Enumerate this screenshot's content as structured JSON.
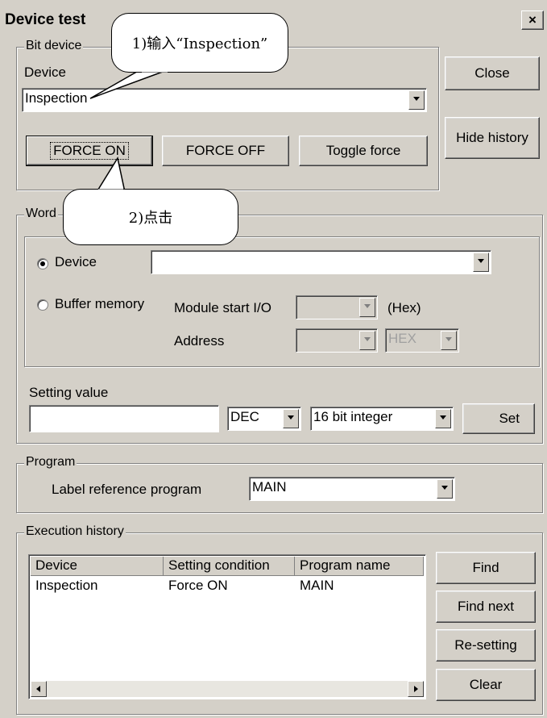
{
  "window": {
    "title": "Device test",
    "close_glyph": "×"
  },
  "bit_device": {
    "group_label": "Bit device",
    "device_label": "Device",
    "device_value": "Inspection",
    "force_on": "FORCE ON",
    "force_off": "FORCE OFF",
    "toggle_force": "Toggle force"
  },
  "side_buttons": {
    "close": "Close",
    "hide_history": "Hide history"
  },
  "word_device": {
    "group_label": "Word",
    "device_radio": "Device",
    "device_value": "",
    "buffer_radio": "Buffer memory",
    "module_start_label": "Module start I/O",
    "hex_label": "(Hex)",
    "address_label": "Address",
    "address_format": "HEX",
    "setting_value_label": "Setting value",
    "setting_value": "",
    "radix": "DEC",
    "data_type": "16 bit integer",
    "set_button": "Set"
  },
  "program": {
    "group_label": "Program",
    "label_ref": "Label reference program",
    "value": "MAIN"
  },
  "execution_history": {
    "group_label": "Execution history",
    "columns": [
      "Device",
      "Setting condition",
      "Program name"
    ],
    "rows": [
      {
        "device": "Inspection",
        "condition": "Force ON",
        "program": "MAIN"
      }
    ],
    "buttons": {
      "find": "Find",
      "find_next": "Find next",
      "resetting": "Re-setting",
      "clear": "Clear"
    }
  },
  "annotations": {
    "step1": "1)输入“Inspection”",
    "step2": "2)点击"
  }
}
